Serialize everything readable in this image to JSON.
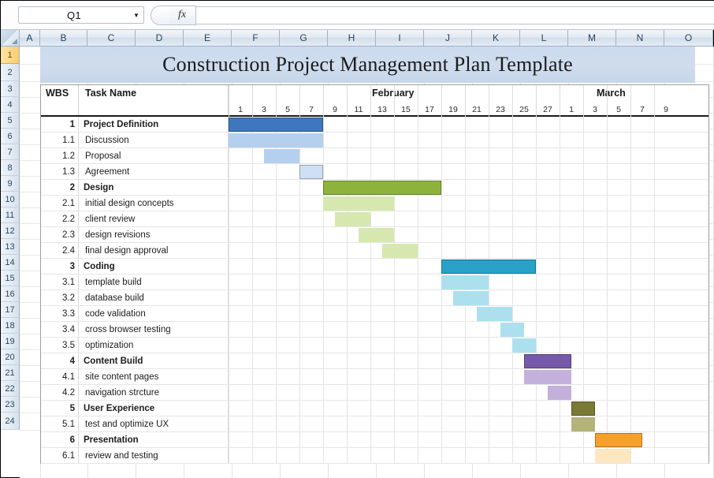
{
  "window": {
    "namebox_value": "Q1",
    "namebox_arrow_icon": "chevron-down-icon",
    "fx_label": "fx",
    "formula_value": ""
  },
  "columns": [
    "A",
    "B",
    "C",
    "D",
    "E",
    "F",
    "G",
    "H",
    "I",
    "J",
    "K",
    "L",
    "M",
    "N",
    "O"
  ],
  "rows": [
    "1",
    "2",
    "3",
    "4",
    "5",
    "6",
    "7",
    "8",
    "9",
    "10",
    "11",
    "12",
    "13",
    "14",
    "15",
    "16",
    "17",
    "18",
    "19",
    "20",
    "21",
    "22",
    "23",
    "24"
  ],
  "selected_row": "1",
  "title": "Construction Project Management Plan Template",
  "table": {
    "header": {
      "wbs": "WBS",
      "task_name": "Task Name",
      "months": [
        {
          "label": "February",
          "start_index": 0,
          "span": 14
        },
        {
          "label": "March",
          "start_index": 14,
          "span": 5
        }
      ],
      "days": [
        "1",
        "3",
        "5",
        "7",
        "9",
        "11",
        "13",
        "15",
        "17",
        "19",
        "21",
        "23",
        "25",
        "27",
        "1",
        "3",
        "5",
        "7",
        "9"
      ]
    },
    "rows": [
      {
        "wbs": "1",
        "task": "Project Definition",
        "summary": true,
        "bar": {
          "start": 0,
          "span": 4,
          "color": "#3d78bf",
          "solid": true
        }
      },
      {
        "wbs": "1.1",
        "task": "Discussion",
        "summary": false,
        "bar": {
          "start": 0,
          "span": 4,
          "color": "#b5cfee",
          "solid": false
        }
      },
      {
        "wbs": "1.2",
        "task": "Proposal",
        "summary": false,
        "bar": {
          "start": 1.5,
          "span": 1.5,
          "color": "#b5cfee",
          "solid": false
        }
      },
      {
        "wbs": "1.3",
        "task": "Agreement",
        "summary": false,
        "bar": {
          "start": 3,
          "span": 1,
          "color": "#cfe0f5",
          "solid": true
        }
      },
      {
        "wbs": "2",
        "task": "Design",
        "summary": true,
        "bar": {
          "start": 4,
          "span": 5,
          "color": "#8db33c",
          "solid": true
        }
      },
      {
        "wbs": "2.1",
        "task": "initial design concepts",
        "summary": false,
        "bar": {
          "start": 4,
          "span": 3,
          "color": "#d6e8af",
          "solid": false
        }
      },
      {
        "wbs": "2.2",
        "task": "client review",
        "summary": false,
        "bar": {
          "start": 4.5,
          "span": 1.5,
          "color": "#d6e8af",
          "solid": false
        }
      },
      {
        "wbs": "2.3",
        "task": "design revisions",
        "summary": false,
        "bar": {
          "start": 5.5,
          "span": 1.5,
          "color": "#d6e8af",
          "solid": false
        }
      },
      {
        "wbs": "2.4",
        "task": "final design approval",
        "summary": false,
        "bar": {
          "start": 6.5,
          "span": 1.5,
          "color": "#d6e8af",
          "solid": false
        }
      },
      {
        "wbs": "3",
        "task": "Coding",
        "summary": true,
        "bar": {
          "start": 9,
          "span": 4,
          "color": "#28a2c8",
          "solid": true
        }
      },
      {
        "wbs": "3.1",
        "task": "template build",
        "summary": false,
        "bar": {
          "start": 9,
          "span": 2,
          "color": "#ade0ee",
          "solid": false
        }
      },
      {
        "wbs": "3.2",
        "task": "database build",
        "summary": false,
        "bar": {
          "start": 9.5,
          "span": 1.5,
          "color": "#ade0ee",
          "solid": false
        }
      },
      {
        "wbs": "3.3",
        "task": "code validation",
        "summary": false,
        "bar": {
          "start": 10.5,
          "span": 1.5,
          "color": "#ade0ee",
          "solid": false
        }
      },
      {
        "wbs": "3.4",
        "task": "cross browser testing",
        "summary": false,
        "bar": {
          "start": 11.5,
          "span": 1,
          "color": "#ade0ee",
          "solid": false
        }
      },
      {
        "wbs": "3.5",
        "task": "optimization",
        "summary": false,
        "bar": {
          "start": 12,
          "span": 1,
          "color": "#ade0ee",
          "solid": false
        }
      },
      {
        "wbs": "4",
        "task": "Content Build",
        "summary": true,
        "bar": {
          "start": 12.5,
          "span": 2,
          "color": "#7659a8",
          "solid": true
        }
      },
      {
        "wbs": "4.1",
        "task": "site content pages",
        "summary": false,
        "bar": {
          "start": 12.5,
          "span": 2,
          "color": "#c3b0db",
          "solid": false
        }
      },
      {
        "wbs": "4.2",
        "task": "navigation strcture",
        "summary": false,
        "bar": {
          "start": 13.5,
          "span": 1,
          "color": "#c3b0db",
          "solid": false
        }
      },
      {
        "wbs": "5",
        "task": "User Experience",
        "summary": true,
        "bar": {
          "start": 14.5,
          "span": 1,
          "color": "#7a7a36",
          "solid": true
        }
      },
      {
        "wbs": "5.1",
        "task": "test and optimize UX",
        "summary": false,
        "bar": {
          "start": 14.5,
          "span": 1,
          "color": "#b3b37a",
          "solid": false
        }
      },
      {
        "wbs": "6",
        "task": "Presentation",
        "summary": true,
        "bar": {
          "start": 15.5,
          "span": 2,
          "color": "#f5a02a",
          "solid": true
        }
      },
      {
        "wbs": "6.1",
        "task": "review and testing",
        "summary": false,
        "bar": {
          "start": 15.5,
          "span": 1.5,
          "color": "#fde6c0",
          "solid": false
        }
      }
    ]
  },
  "colors": {
    "title_band": "#ccdbee",
    "header_rule": "#1a1a1a",
    "grid": "#e2e2e2"
  }
}
